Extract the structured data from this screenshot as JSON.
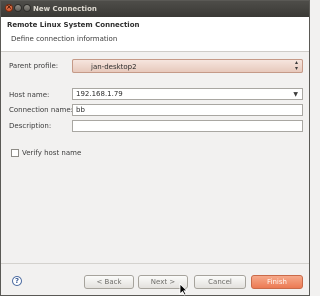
{
  "window": {
    "title": "New Connection"
  },
  "header": {
    "title": "Remote Linux System Connection",
    "subtitle": "Define connection information"
  },
  "form": {
    "parent_profile": {
      "label": "Parent profile:",
      "value": "jan-desktop2"
    },
    "host_name": {
      "label": "Host name:",
      "value": "192.168.1.79"
    },
    "connection_name": {
      "label": "Connection name:",
      "value": "bb"
    },
    "description": {
      "label": "Description:",
      "value": ""
    },
    "verify_host": {
      "label": "Verify host name",
      "checked": false
    }
  },
  "buttons": {
    "help": "?",
    "back": "< Back",
    "next": "Next >",
    "cancel": "Cancel",
    "finish": "Finish"
  },
  "colors": {
    "accent": "#ec7a54",
    "titlebar": "#3c3b37"
  }
}
